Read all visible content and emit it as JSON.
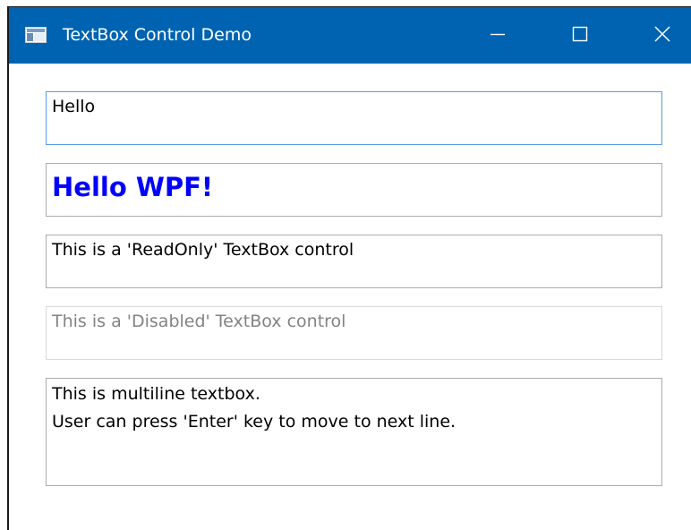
{
  "window": {
    "title": "TextBox Control Demo",
    "icon": "app-window-icon",
    "title_bar_color": "#0063b1",
    "caption_buttons": {
      "minimize": "minimize-icon",
      "maximize": "maximize-icon",
      "close": "close-icon"
    }
  },
  "textboxes": [
    {
      "value": "Hello",
      "state": "focused",
      "border_color": "#569de5"
    },
    {
      "value": "Hello WPF!",
      "state": "normal",
      "foreground": "#0000ff",
      "font_weight": "bold"
    },
    {
      "value": "This is a 'ReadOnly' TextBox control",
      "state": "readonly"
    },
    {
      "value": "This is a 'Disabled' TextBox control",
      "state": "disabled",
      "foreground": "#838383"
    },
    {
      "lines": [
        "This is multiline textbox.",
        "User can press 'Enter' key to move to next line."
      ],
      "state": "multiline"
    }
  ]
}
